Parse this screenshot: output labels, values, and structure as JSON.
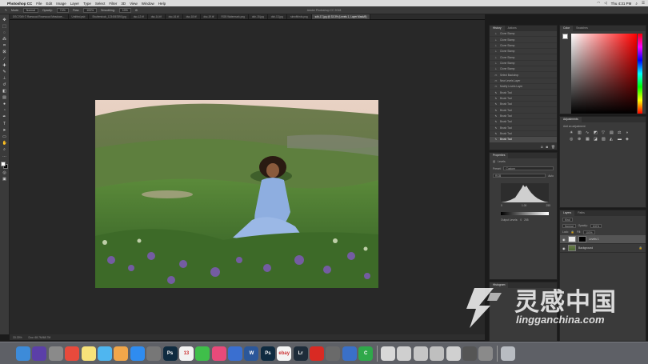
{
  "menubar": {
    "app": "Photoshop CC",
    "items": [
      "File",
      "Edit",
      "Image",
      "Layer",
      "Type",
      "Select",
      "Filter",
      "3D",
      "View",
      "Window",
      "Help"
    ],
    "clock": "Thu 4:31 PM"
  },
  "optbar": {
    "window_title": "Adobe Photoshop CC 2018",
    "mode_label": "Mode:",
    "mode_value": "Normal",
    "opacity_label": "Opacity:",
    "opacity_value": "74%",
    "flow_label": "Flow:",
    "flow_value": "100%",
    "smoothing_label": "Smoothing:",
    "smoothing_value": "10%"
  },
  "tabs": [
    {
      "label": "DSC7069 © Raewood Rosewood Meadows..."
    },
    {
      "label": "Untitled.psb"
    },
    {
      "label": "Shutterstock_1234567890.jpg"
    },
    {
      "label": "dsc-12.tif"
    },
    {
      "label": "dsc-14.tif"
    },
    {
      "label": "dsc-16.tif"
    },
    {
      "label": "dsc-18.tif"
    },
    {
      "label": "dsc-19.tif"
    },
    {
      "label": "RGB Watermark.png"
    },
    {
      "label": "dsh-15.jpg"
    },
    {
      "label": "dsh-13.jpg"
    },
    {
      "label": "ruleofthirds.png"
    },
    {
      "label": "sdh-17.jpg @ 33.3% (Levels 1, Layer Mask/8)"
    }
  ],
  "history": {
    "tabs": [
      "History",
      "Actions"
    ],
    "items": [
      {
        "icon": "clone-stamp-icon",
        "label": "Clone Stamp"
      },
      {
        "icon": "clone-stamp-icon",
        "label": "Clone Stamp"
      },
      {
        "icon": "clone-stamp-icon",
        "label": "Clone Stamp"
      },
      {
        "icon": "clone-stamp-icon",
        "label": "Clone Stamp"
      },
      {
        "icon": "clone-stamp-icon",
        "label": "Clone Stamp"
      },
      {
        "icon": "clone-stamp-icon",
        "label": "Clone Stamp"
      },
      {
        "icon": "clone-stamp-icon",
        "label": "Clone Stamp"
      },
      {
        "icon": "layer-icon",
        "label": "Select Backdrop"
      },
      {
        "icon": "layer-icon",
        "label": "New Levels Layer"
      },
      {
        "icon": "layer-icon",
        "label": "Modify Levels Layer"
      },
      {
        "icon": "brush-icon",
        "label": "Brush Tool"
      },
      {
        "icon": "brush-icon",
        "label": "Brush Tool"
      },
      {
        "icon": "brush-icon",
        "label": "Brush Tool"
      },
      {
        "icon": "brush-icon",
        "label": "Brush Tool"
      },
      {
        "icon": "brush-icon",
        "label": "Brush Tool"
      },
      {
        "icon": "brush-icon",
        "label": "Brush Tool"
      },
      {
        "icon": "brush-icon",
        "label": "Brush Tool"
      },
      {
        "icon": "brush-icon",
        "label": "Brush Tool"
      },
      {
        "icon": "brush-icon",
        "label": "Brush Tool"
      }
    ]
  },
  "color_panel": {
    "tabs": [
      "Color",
      "Swatches"
    ]
  },
  "adjustments": {
    "tabs": [
      "Adjustments"
    ],
    "hint": "Add an adjustment"
  },
  "properties": {
    "tabs": [
      "Properties"
    ],
    "type": "Levels",
    "preset_label": "Preset:",
    "preset_value": "Custom",
    "channel_value": "RGB",
    "auto_label": "Auto",
    "input_values": [
      "0",
      "1.00",
      "255"
    ],
    "output_label": "Output Levels:",
    "output_values": [
      "0",
      "255"
    ]
  },
  "layers": {
    "tabs": [
      "Layers",
      "Paths"
    ],
    "kind_label": "Kind",
    "blend_value": "Normal",
    "opacity_label": "Opacity:",
    "opacity_value": "100%",
    "lock_label": "Lock:",
    "fill_label": "Fill:",
    "fill_value": "100%",
    "items": [
      {
        "name": "Levels 1",
        "selected": true
      },
      {
        "name": "Background",
        "selected": false
      }
    ]
  },
  "histogram_panel": {
    "tabs": [
      "Histogram"
    ]
  },
  "statusbar": {
    "zoom": "33.33%",
    "doc": "Doc: 68.7M/68.7M"
  },
  "watermark": {
    "chinese": "灵感中国",
    "english": "lingganchina.com"
  },
  "dock": [
    {
      "icon": "finder-icon",
      "label": "",
      "color": "#3d8bd9"
    },
    {
      "icon": "siri-icon",
      "label": "",
      "color": "#5b3fa8"
    },
    {
      "icon": "launchpad-icon",
      "label": "",
      "color": "#8a8a8a"
    },
    {
      "icon": "chrome-icon",
      "label": "",
      "color": "#e84a3c"
    },
    {
      "icon": "notes-icon",
      "label": "",
      "color": "#f7e27a"
    },
    {
      "icon": "messages-icon",
      "label": "",
      "color": "#4fb6f0"
    },
    {
      "icon": "photos-icon",
      "label": "",
      "color": "#f1a64a"
    },
    {
      "icon": "app-store-icon",
      "label": "",
      "color": "#2f8cf0"
    },
    {
      "icon": "system-preferences-icon",
      "label": "",
      "color": "#777777"
    },
    {
      "icon": "photoshop-icon",
      "label": "Ps",
      "color": "#0f2b40"
    },
    {
      "icon": "calendar-icon",
      "label": "13",
      "color": "#f2f2f2"
    },
    {
      "icon": "facetime-icon",
      "label": "",
      "color": "#3fbf4a"
    },
    {
      "icon": "itunes-icon",
      "label": "",
      "color": "#e84a7a"
    },
    {
      "icon": "keynote-icon",
      "label": "",
      "color": "#3a6fd0"
    },
    {
      "icon": "word-icon",
      "label": "W",
      "color": "#2b579a"
    },
    {
      "icon": "photoshop-icon",
      "label": "Ps",
      "color": "#0f2b40"
    },
    {
      "icon": "ebay-icon",
      "label": "ebay",
      "color": "#f4f4f4"
    },
    {
      "icon": "lightroom-icon",
      "label": "Lr",
      "color": "#1e2c3a"
    },
    {
      "icon": "acrobat-icon",
      "label": "",
      "color": "#d92a23"
    },
    {
      "icon": "image-capture-icon",
      "label": "",
      "color": "#6a6a6a"
    },
    {
      "icon": "quicktime-icon",
      "label": "",
      "color": "#3a70c8"
    },
    {
      "icon": "camtasia-icon",
      "label": "C",
      "color": "#2fa84a"
    },
    {
      "icon": "document-stack-icon",
      "label": "",
      "color": "#d8d8d8"
    },
    {
      "icon": "document-stack-icon",
      "label": "",
      "color": "#cfcfcf"
    },
    {
      "icon": "document-stack-icon",
      "label": "",
      "color": "#c6c6c6"
    },
    {
      "icon": "document-stack-icon",
      "label": "",
      "color": "#bfbfbf"
    },
    {
      "icon": "document-stack-icon",
      "label": "",
      "color": "#d0d0d0"
    },
    {
      "icon": "document-stack-icon",
      "label": "",
      "color": "#555555"
    },
    {
      "icon": "document-stack-icon",
      "label": "",
      "color": "#8a8a8a"
    },
    {
      "icon": "trash-icon",
      "label": "",
      "color": "#b8bcc2"
    }
  ]
}
